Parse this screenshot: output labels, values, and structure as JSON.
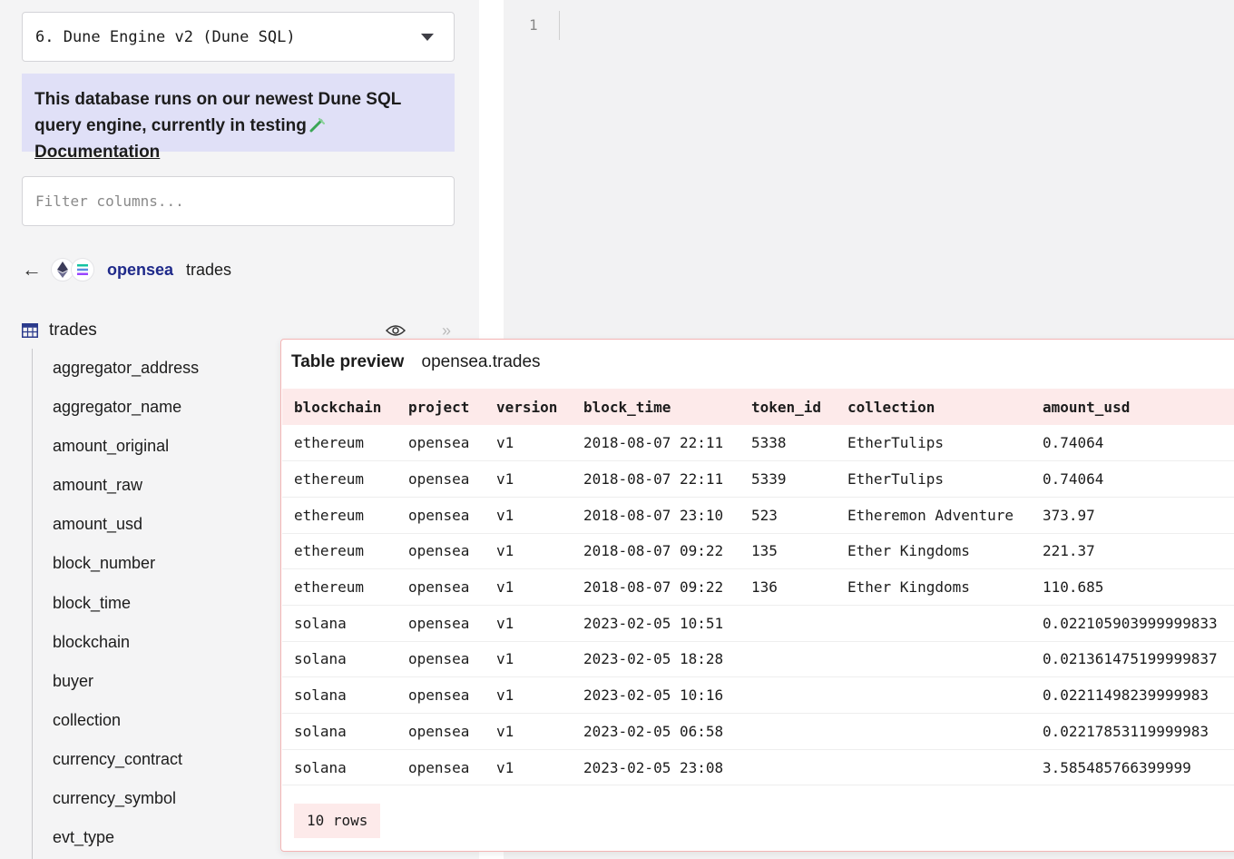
{
  "sidebar": {
    "engine_label": "6. Dune Engine v2 (Dune SQL)",
    "notice": {
      "text": "This database runs on our newest Dune SQL query engine, currently in testing",
      "link": "Documentation"
    },
    "filter_placeholder": "Filter columns...",
    "breadcrumb": {
      "namespace": "opensea",
      "table": "trades",
      "chain_icons": [
        "ethereum-icon",
        "solana-icon"
      ]
    },
    "table_name": "trades",
    "columns": [
      "aggregator_address",
      "aggregator_name",
      "amount_original",
      "amount_raw",
      "amount_usd",
      "block_number",
      "block_time",
      "blockchain",
      "buyer",
      "collection",
      "currency_contract",
      "currency_symbol",
      "evt_type"
    ]
  },
  "editor": {
    "line_number": "1"
  },
  "preview": {
    "label": "Table preview",
    "table": "opensea.trades",
    "headers": [
      "blockchain",
      "project",
      "version",
      "block_time",
      "token_id",
      "collection",
      "amount_usd"
    ],
    "rows": [
      [
        "ethereum",
        "opensea",
        "v1",
        "2018-08-07 22:11",
        "5338",
        "EtherTulips",
        "0.74064"
      ],
      [
        "ethereum",
        "opensea",
        "v1",
        "2018-08-07 22:11",
        "5339",
        "EtherTulips",
        "0.74064"
      ],
      [
        "ethereum",
        "opensea",
        "v1",
        "2018-08-07 23:10",
        "523",
        "Etheremon Adventure",
        "373.97"
      ],
      [
        "ethereum",
        "opensea",
        "v1",
        "2018-08-07 09:22",
        "135",
        "Ether Kingdoms",
        "221.37"
      ],
      [
        "ethereum",
        "opensea",
        "v1",
        "2018-08-07 09:22",
        "136",
        "Ether Kingdoms",
        "110.685"
      ],
      [
        "solana",
        "opensea",
        "v1",
        "2023-02-05 10:51",
        "",
        "",
        "0.022105903999999833"
      ],
      [
        "solana",
        "opensea",
        "v1",
        "2023-02-05 18:28",
        "",
        "",
        "0.021361475199999837"
      ],
      [
        "solana",
        "opensea",
        "v1",
        "2023-02-05 10:16",
        "",
        "",
        "0.02211498239999983"
      ],
      [
        "solana",
        "opensea",
        "v1",
        "2023-02-05 06:58",
        "",
        "",
        "0.02217853119999983"
      ],
      [
        "solana",
        "opensea",
        "v1",
        "2023-02-05 23:08",
        "",
        "",
        "3.585485766399999"
      ]
    ],
    "row_count": "10 rows"
  },
  "colors": {
    "notice_bg": "#e0e0f7",
    "namespace": "#1f2a8a",
    "preview_header_bg": "#fdeaea",
    "preview_border": "#f4b5b5"
  }
}
